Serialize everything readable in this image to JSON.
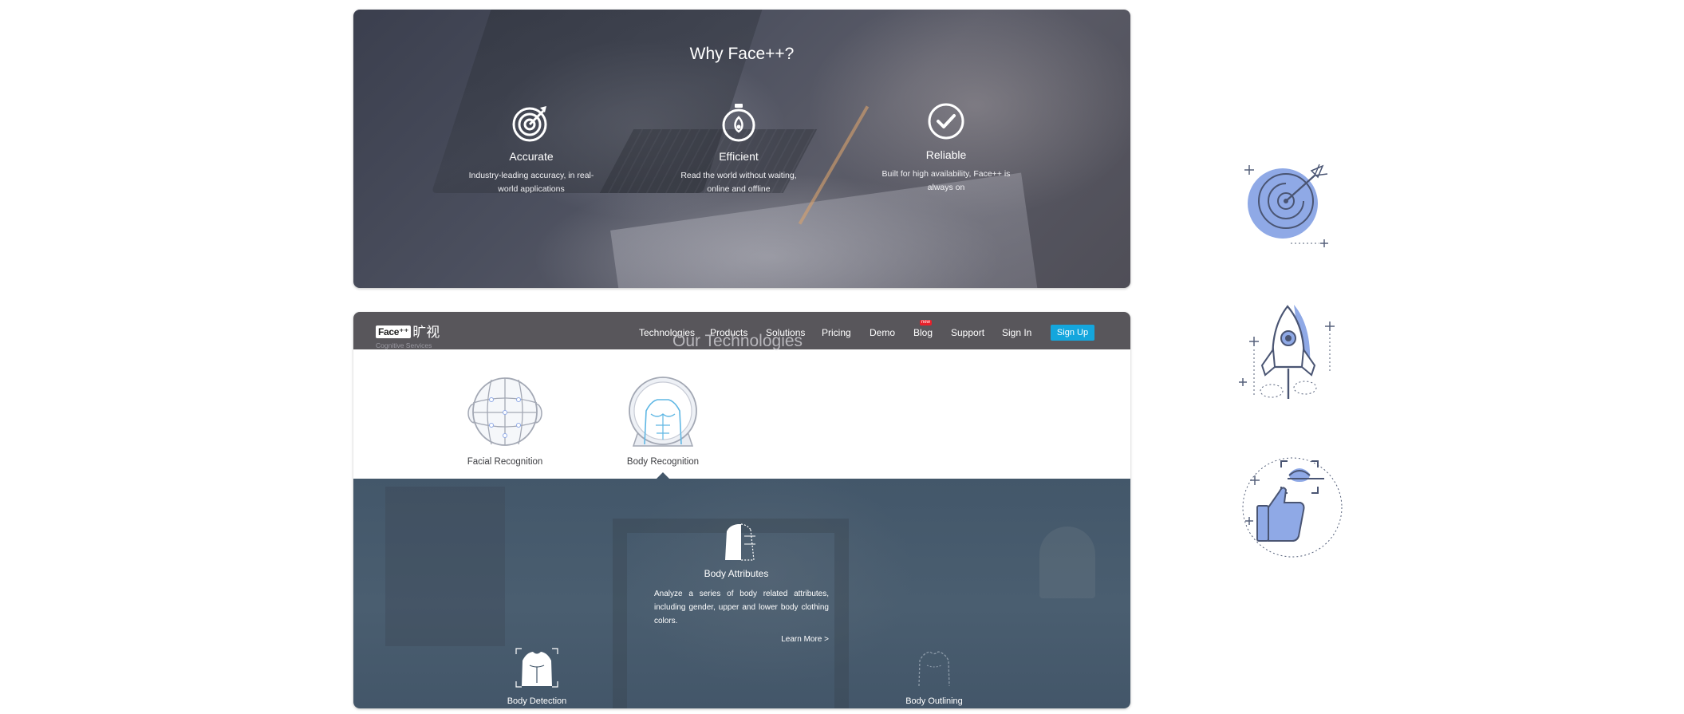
{
  "why_section": {
    "title": "Why Face++?",
    "features": [
      {
        "icon": "target-icon",
        "title": "Accurate",
        "description": "Industry-leading accuracy, in real-world applications"
      },
      {
        "icon": "stopwatch-icon",
        "title": "Efficient",
        "description": "Read the world without waiting, online and offline"
      },
      {
        "icon": "check-circle-icon",
        "title": "Reliable",
        "description": "Built for high availability, Face++ is always on"
      }
    ]
  },
  "navbar": {
    "logo_text": "Face⁺⁺",
    "logo_cn": "旷视",
    "logo_sub": "Cognitive Services",
    "items": [
      "Technologies",
      "Products",
      "Solutions",
      "Pricing",
      "Demo",
      "Blog",
      "Support",
      "Sign In"
    ],
    "blog_badge": "new",
    "signup": "Sign Up",
    "signup_color": "#14a6dd"
  },
  "technologies": {
    "title": "Our Technologies",
    "cards": [
      {
        "icon": "face-grid-icon",
        "label": "Facial Recognition"
      },
      {
        "icon": "body-torso-icon",
        "label": "Body Recognition"
      }
    ],
    "selected_index": 1
  },
  "detail": {
    "icon": "body-attributes-icon",
    "title": "Body Attributes",
    "description": "Analyze a series of body related attributes, including gender, upper and lower body clothing colors.",
    "learn_more": "Learn More >",
    "sub_items": [
      {
        "icon": "body-detection-icon",
        "label": "Body Detection"
      },
      {
        "icon": "body-outlining-icon",
        "label": "Body Outlining"
      }
    ]
  },
  "illustrations": [
    "target-arrow-illustration",
    "rocket-illustration",
    "thumbs-up-illustration"
  ],
  "colors": {
    "accent_blue": "#14a6dd",
    "illustration_blue": "#8fa9e6",
    "navbar_bg": "#58565b",
    "detail_bg": "#43576a"
  }
}
